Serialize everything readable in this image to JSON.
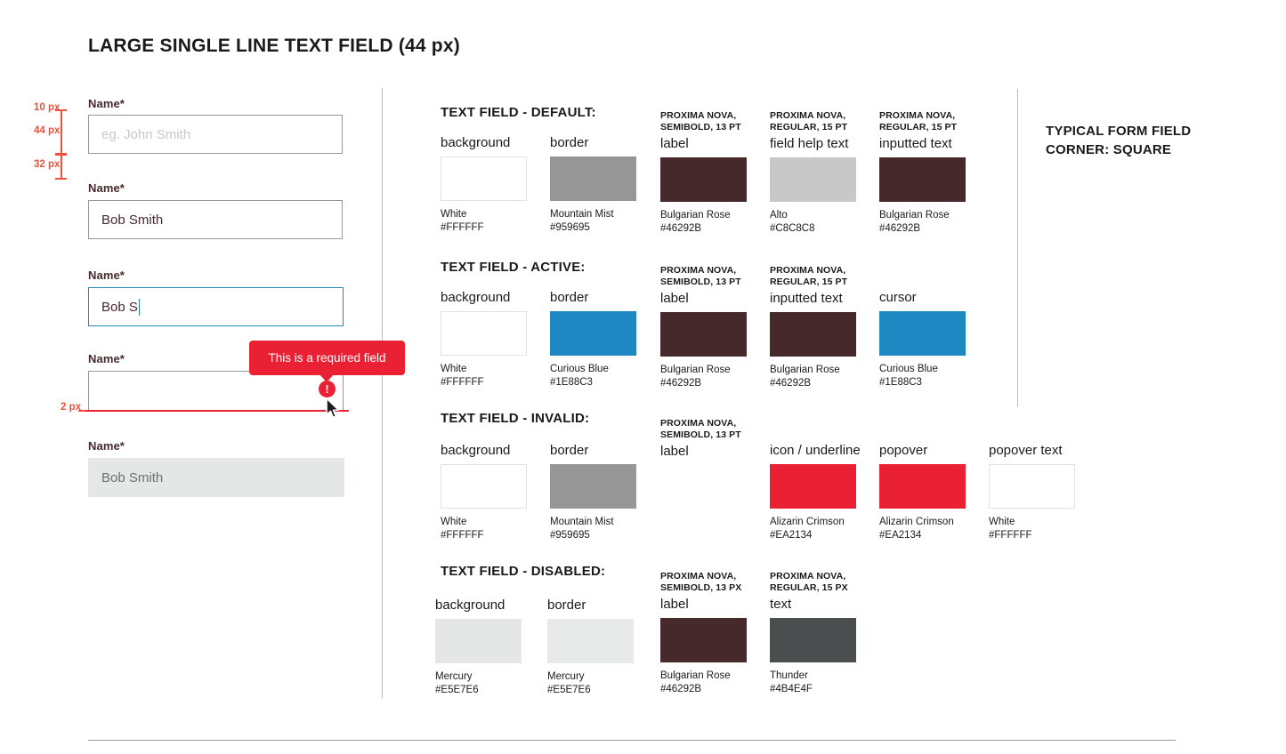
{
  "page": {
    "title": "LARGE SINGLE LINE TEXT FIELD (44 px)"
  },
  "measurements": {
    "top_spacing": "10 px",
    "field_height": "44 px",
    "bottom_spacing": "32 px",
    "underline_thickness": "2 px"
  },
  "fields": {
    "default": {
      "label": "Name*",
      "placeholder": "eg. John Smith",
      "value": ""
    },
    "filled": {
      "label": "Name*",
      "value": "Bob Smith"
    },
    "active": {
      "label": "Name*",
      "value": "Bob S"
    },
    "invalid": {
      "label": "Name*",
      "value": "",
      "popover_text": "This is a required field",
      "error_icon_glyph": "!"
    },
    "disabled": {
      "label": "Name*",
      "value": "Bob Smith"
    }
  },
  "sections": [
    {
      "title": "TEXT FIELD - DEFAULT:",
      "columns": [
        {
          "spec": "",
          "role": "background",
          "swatch": "#FFFFFF",
          "outlined": true,
          "color_name": "White",
          "hex": "#FFFFFF"
        },
        {
          "spec": "",
          "role": "border",
          "swatch": "#959695",
          "outlined": false,
          "color_name": "Mountain Mist",
          "hex": "#959695"
        },
        {
          "spec": "PROXIMA NOVA,\nSEMIBOLD, 13 PT",
          "role": "label",
          "swatch": "#46292B",
          "outlined": false,
          "color_name": "Bulgarian Rose",
          "hex": "#46292B"
        },
        {
          "spec": "PROXIMA NOVA,\nREGULAR, 15 PT",
          "role": "field help text",
          "swatch": "#C8C8C8",
          "outlined": false,
          "color_name": "Alto",
          "hex": "#C8C8C8"
        },
        {
          "spec": "PROXIMA NOVA,\nREGULAR, 15 PT",
          "role": "inputted text",
          "swatch": "#46292B",
          "outlined": false,
          "color_name": "Bulgarian Rose",
          "hex": "#46292B"
        }
      ]
    },
    {
      "title": "TEXT FIELD - ACTIVE:",
      "columns": [
        {
          "spec": "",
          "role": "background",
          "swatch": "#FFFFFF",
          "outlined": true,
          "color_name": "White",
          "hex": "#FFFFFF"
        },
        {
          "spec": "",
          "role": "border",
          "swatch": "#1E88C3",
          "outlined": false,
          "color_name": "Curious Blue",
          "hex": "#1E88C3"
        },
        {
          "spec": "PROXIMA NOVA,\nSEMIBOLD, 13 PT",
          "role": "label",
          "swatch": "#46292B",
          "outlined": false,
          "color_name": "Bulgarian Rose",
          "hex": "#46292B"
        },
        {
          "spec": "PROXIMA NOVA,\nREGULAR, 15 PT",
          "role": "inputted text",
          "swatch": "#46292B",
          "outlined": false,
          "color_name": "Bulgarian Rose",
          "hex": "#46292B"
        },
        {
          "spec": "",
          "role": "cursor",
          "swatch": "#1E88C3",
          "outlined": false,
          "color_name": "Curious Blue",
          "hex": "#1E88C3"
        }
      ]
    },
    {
      "title": "TEXT FIELD - INVALID:",
      "columns": [
        {
          "spec": "",
          "role": "background",
          "swatch": "#FFFFFF",
          "outlined": true,
          "color_name": "White",
          "hex": "#FFFFFF"
        },
        {
          "spec": "",
          "role": "border",
          "swatch": "#959695",
          "outlined": false,
          "color_name": "Mountain Mist",
          "hex": "#959695"
        },
        {
          "spec": "PROXIMA NOVA,\nSEMIBOLD, 13 PT",
          "role": "label",
          "swatch": "",
          "outlined": false,
          "color_name": "",
          "hex": ""
        },
        {
          "spec": "",
          "role": "icon / underline",
          "swatch": "#EA2134",
          "outlined": false,
          "color_name": "Alizarin Crimson",
          "hex": "#EA2134"
        },
        {
          "spec": "",
          "role": "popover",
          "swatch": "#EA2134",
          "outlined": false,
          "color_name": "Alizarin Crimson",
          "hex": "#EA2134"
        },
        {
          "spec": "",
          "role": "popover text",
          "swatch": "#FFFFFF",
          "outlined": true,
          "color_name": "White",
          "hex": "#FFFFFF"
        }
      ]
    },
    {
      "title": "TEXT FIELD - DISABLED:",
      "columns": [
        {
          "spec": "",
          "role": "background",
          "swatch": "#E5E7E6",
          "outlined": false,
          "color_name": "Mercury",
          "hex": "#E5E7E6"
        },
        {
          "spec": "",
          "role": "border",
          "swatch": "#E8EAE9",
          "outlined": false,
          "color_name": "Mercury",
          "hex": "#E5E7E6"
        },
        {
          "spec": "PROXIMA NOVA,\nSEMIBOLD, 13 PX",
          "role": "label",
          "swatch": "#46292B",
          "outlined": false,
          "color_name": "Bulgarian Rose",
          "hex": "#46292B"
        },
        {
          "spec": "PROXIMA NOVA,\nREGULAR, 15 PX",
          "role": "text",
          "swatch": "#4B4E4F",
          "outlined": false,
          "color_name": "Thunder",
          "hex": "#4B4E4F"
        }
      ]
    }
  ],
  "side_note": {
    "text": "TYPICAL FORM FIELD\nCORNER:  SQUARE"
  }
}
